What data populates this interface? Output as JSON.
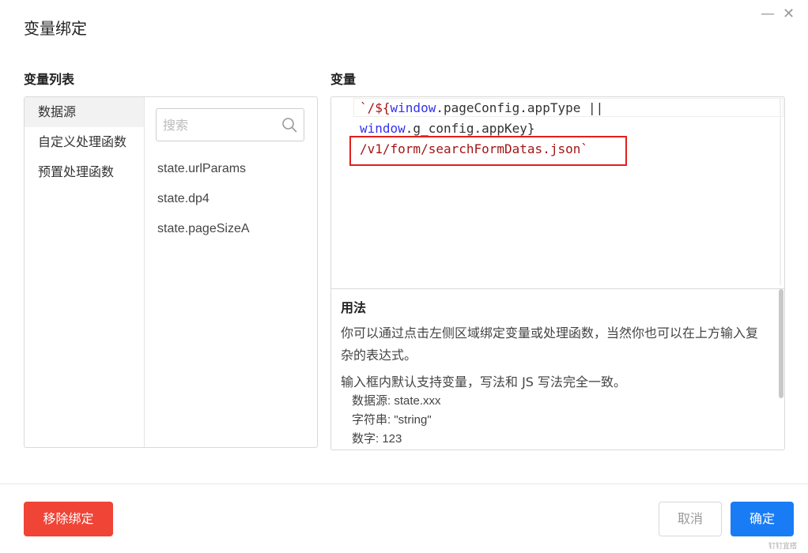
{
  "dialog": {
    "title": "变量绑定",
    "minimize_glyph": "—",
    "close_glyph": "✕"
  },
  "left": {
    "label": "变量列表",
    "categories": [
      "数据源",
      "自定义处理函数",
      "预置处理函数"
    ],
    "search_placeholder": "搜索",
    "variables": [
      "state.urlParams",
      "state.dp4",
      "state.pageSizeA"
    ]
  },
  "right": {
    "label": "变量",
    "code": {
      "l1_open": "`/${",
      "l1_kw": "window",
      "l1_rest": ".pageConfig.appType ||",
      "l2_kw": "window",
      "l2_rest": ".g_config.appKey}",
      "l3_str": "/v1/form/searchFormDatas.json",
      "l3_close": "`"
    },
    "usage": {
      "title": "用法",
      "desc": "你可以通过点击左侧区域绑定变量或处理函数，当然你也可以在上方输入复杂的表达式。",
      "desc2": "输入框内默认支持变量，写法和 JS 写法完全一致。",
      "examples": [
        "数据源: state.xxx",
        "字符串: \"string\"",
        "数字: 123"
      ]
    }
  },
  "footer": {
    "remove_label": "移除绑定",
    "cancel_label": "取消",
    "ok_label": "确定"
  },
  "watermark": "钉钉宜搭",
  "colors": {
    "danger": "#ef4436",
    "primary": "#1a7cf5",
    "highlight": "#e0201b",
    "code_string": "#a31515",
    "code_keyword": "#3333ee"
  },
  "icons": [
    "search-icon",
    "minimize-icon",
    "close-icon"
  ]
}
